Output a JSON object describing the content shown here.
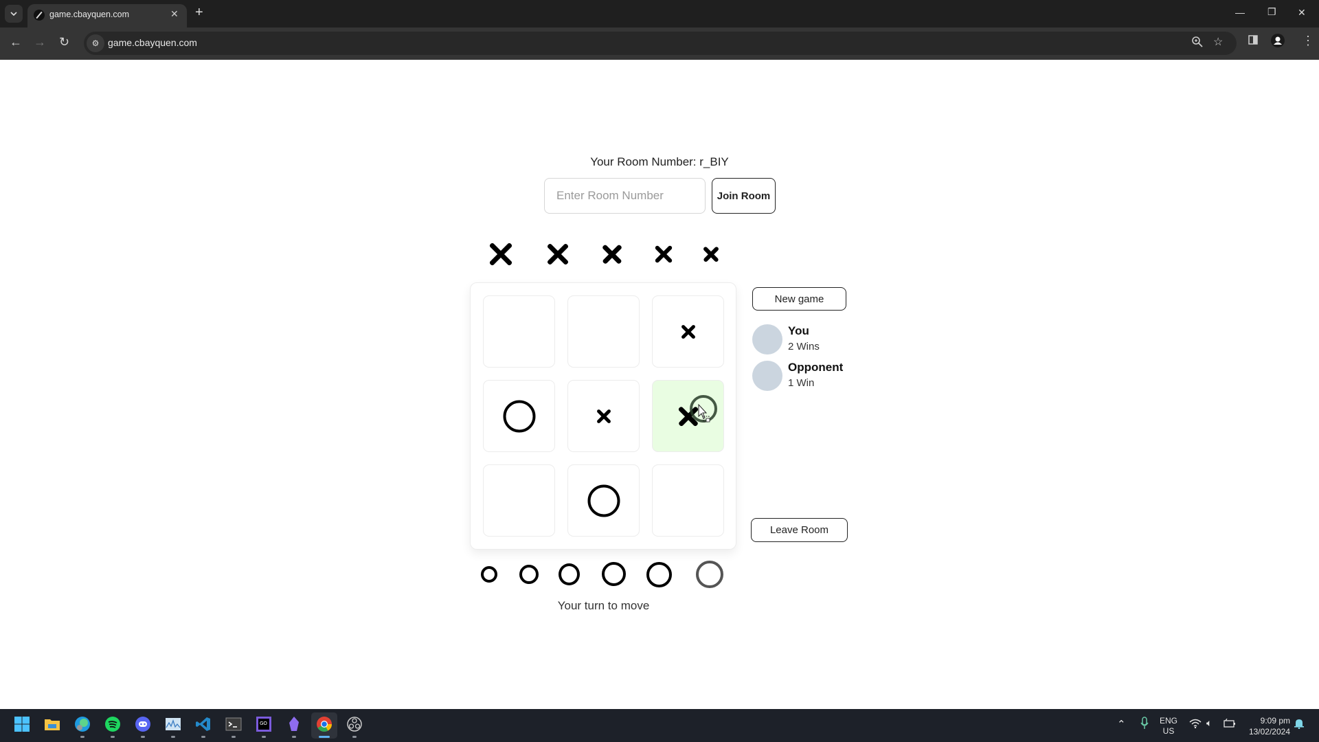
{
  "browser": {
    "tab_title": "game.cbayquen.com",
    "url": "game.cbayquen.com",
    "icons": {
      "tab_list": "chevron-down-icon",
      "favicon": "slash-favicon",
      "tab_close": "close-icon",
      "new_tab": "plus-icon",
      "back": "back-arrow-icon",
      "forward": "forward-arrow-icon",
      "reload": "reload-icon",
      "site_info": "site-settings-icon",
      "zoom": "zoom-icon",
      "bookmark": "star-icon",
      "side_panel": "side-panel-icon",
      "profile": "profile-icon",
      "menu": "kebab-menu-icon",
      "minimize": "minimize-icon",
      "restore": "restore-icon",
      "close": "close-window-icon"
    }
  },
  "room": {
    "label": "Your Room Number: r_BIY",
    "input_placeholder": "Enter Room Number",
    "input_value": "",
    "join_label": "Join Room"
  },
  "remaining_x_pieces": 5,
  "remaining_o_pieces": 6,
  "board": {
    "cells": [
      {
        "row": 0,
        "col": 0,
        "pieces": []
      },
      {
        "row": 0,
        "col": 1,
        "pieces": []
      },
      {
        "row": 0,
        "col": 2,
        "pieces": [
          {
            "mark": "X",
            "size": "small"
          }
        ]
      },
      {
        "row": 1,
        "col": 0,
        "pieces": [
          {
            "mark": "O",
            "size": "large"
          }
        ]
      },
      {
        "row": 1,
        "col": 1,
        "pieces": [
          {
            "mark": "X",
            "size": "small"
          }
        ]
      },
      {
        "row": 1,
        "col": 2,
        "pieces": [
          {
            "mark": "X",
            "size": "medium"
          },
          {
            "mark": "O",
            "size": "medium",
            "dragging": true
          }
        ],
        "highlighted": true
      },
      {
        "row": 2,
        "col": 0,
        "pieces": []
      },
      {
        "row": 2,
        "col": 1,
        "pieces": [
          {
            "mark": "O",
            "size": "large"
          }
        ]
      },
      {
        "row": 2,
        "col": 2,
        "pieces": []
      }
    ],
    "highlight_color": "#e9fde2"
  },
  "controls": {
    "new_game_label": "New game",
    "leave_room_label": "Leave Room"
  },
  "players": [
    {
      "name": "You",
      "wins": "2 Wins",
      "avatar_color": "#cbd5df"
    },
    {
      "name": "Opponent",
      "wins": "1 Win",
      "avatar_color": "#cbd5df"
    }
  ],
  "status": "Your turn to move",
  "taskbar": {
    "apps": [
      {
        "name": "start",
        "icon": "windows-start-icon",
        "active": false,
        "running": false
      },
      {
        "name": "file-explorer",
        "icon": "folder-icon",
        "active": false,
        "running": false
      },
      {
        "name": "edge",
        "icon": "edge-icon",
        "active": false,
        "running": true
      },
      {
        "name": "spotify",
        "icon": "spotify-icon",
        "active": false,
        "running": true
      },
      {
        "name": "discord",
        "icon": "discord-icon",
        "active": false,
        "running": true
      },
      {
        "name": "resource-monitor",
        "icon": "monitor-chart-icon",
        "active": false,
        "running": true
      },
      {
        "name": "vscode",
        "icon": "vscode-icon",
        "active": false,
        "running": true
      },
      {
        "name": "terminal",
        "icon": "terminal-icon",
        "active": false,
        "running": true
      },
      {
        "name": "goland",
        "icon": "goland-icon",
        "active": false,
        "running": true
      },
      {
        "name": "obsidian",
        "icon": "obsidian-icon",
        "active": false,
        "running": true
      },
      {
        "name": "chrome",
        "icon": "chrome-icon",
        "active": true,
        "running": true
      },
      {
        "name": "obs",
        "icon": "obs-icon",
        "active": false,
        "running": true
      }
    ],
    "tray": {
      "lang_top": "ENG",
      "lang_bottom": "US",
      "time": "9:09 pm",
      "date": "13/02/2024"
    }
  }
}
